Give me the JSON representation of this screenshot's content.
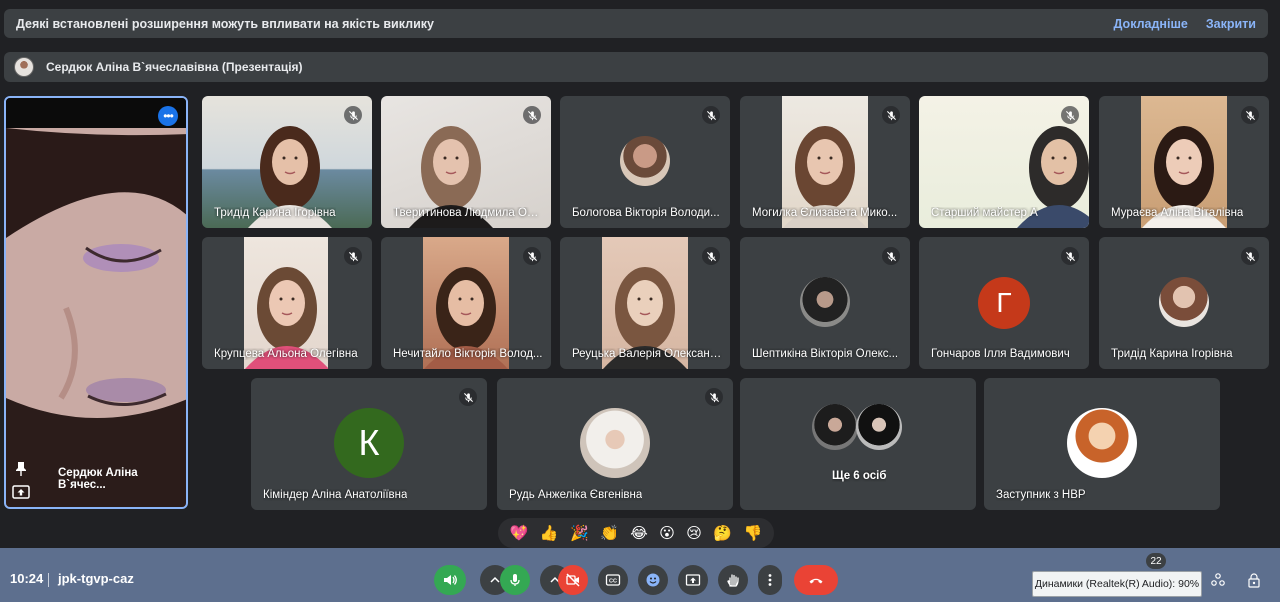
{
  "banner": {
    "text": "Деякі встановлені розширення можуть впливати на якість виклику",
    "more_link": "Докладніше",
    "close_link": "Закрити"
  },
  "presentation": {
    "title": "Сердюк Аліна В`ячеславівна (Презентація)"
  },
  "featured": {
    "name": "Сердюк Аліна В`ячес...",
    "more_icon": "more-options-icon",
    "pin_icon": "pin-icon",
    "present_icon": "present-screen-icon"
  },
  "participants": [
    {
      "name": "Тридід Карина Ігорівна",
      "muted": true,
      "kind": "video"
    },
    {
      "name": "Тверитинова Людмила Ол...",
      "muted": true,
      "kind": "video"
    },
    {
      "name": "Бологова Вікторія Володи...",
      "muted": true,
      "kind": "photo"
    },
    {
      "name": "Могилка Єлизавета Мико...",
      "muted": true,
      "kind": "video"
    },
    {
      "name": "Старший майстер А",
      "muted": true,
      "kind": "video"
    },
    {
      "name": "Мураєва Аліна Віталівна",
      "muted": true,
      "kind": "video"
    },
    {
      "name": "Крупцева Альона Олегівна",
      "muted": true,
      "kind": "video"
    },
    {
      "name": "Нечитайло Вікторія Волод...",
      "muted": true,
      "kind": "video"
    },
    {
      "name": "Реуцька Валерія Олександ...",
      "muted": true,
      "kind": "video"
    },
    {
      "name": "Шептикіна Вікторія Олекс...",
      "muted": true,
      "kind": "photo"
    },
    {
      "name": "Гончаров Ілля Вадимович",
      "muted": true,
      "kind": "letter",
      "letter": "Г",
      "color": "#c5391a"
    },
    {
      "name": "Тридід Карина Ігорівна",
      "muted": true,
      "kind": "photo"
    },
    {
      "name": "Кіміндер Аліна Анатоліївна",
      "muted": true,
      "kind": "letter",
      "letter": "К",
      "color": "#33691e"
    },
    {
      "name": "Рудь Анжеліка Євгенівна",
      "muted": true,
      "kind": "photo"
    },
    {
      "name": "Ще 6 осіб",
      "muted": false,
      "kind": "group"
    },
    {
      "name": "Заступник з НВР",
      "muted": false,
      "kind": "photo"
    }
  ],
  "reactions": [
    "💖",
    "👍",
    "🎉",
    "👏",
    "😂",
    "😮",
    "😢",
    "🤔",
    "👎"
  ],
  "bottom_bar": {
    "time": "10:24",
    "meeting_code": "jpk-tgvp-caz",
    "participant_count": "22",
    "tooltip": "Динамики (Realtek(R) Audio): 90%",
    "colors": {
      "speaker": "#34a853",
      "mic": "#34a853",
      "camera_off": "#ea4335",
      "hangup": "#ea4335",
      "neutral": "#3c4043"
    }
  }
}
